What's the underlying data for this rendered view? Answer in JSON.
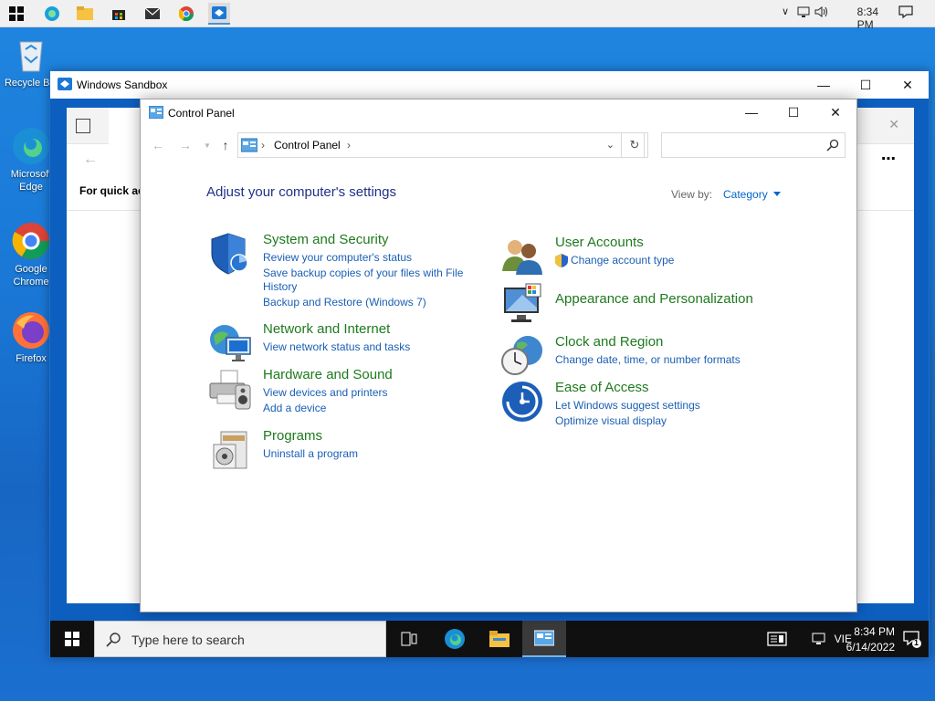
{
  "host_tray": {
    "time": "8:34 PM"
  },
  "desktop": {
    "icons": [
      "Recycle Bin",
      "Microsoft Edge",
      "Google Chrome",
      "Firefox"
    ]
  },
  "sandbox": {
    "title": "Windows Sandbox",
    "explorer_quick": "For quick ac"
  },
  "sandbox_taskbar": {
    "search_placeholder": "Type here to search",
    "lang": "VIE",
    "time": "8:34 PM",
    "date": "6/14/2022",
    "notifications": "1"
  },
  "control_panel": {
    "title": "Control Panel",
    "breadcrumb": "Control Panel",
    "heading": "Adjust your computer's settings",
    "view_by_label": "View by:",
    "view_by_value": "Category",
    "categories": [
      {
        "title": "System and Security",
        "icon": "shield-icon",
        "links": [
          "Review your computer's status",
          "Save backup copies of your files with File History",
          "Backup and Restore (Windows 7)"
        ]
      },
      {
        "title": "Network and Internet",
        "icon": "network-icon",
        "links": [
          "View network status and tasks"
        ]
      },
      {
        "title": "Hardware and Sound",
        "icon": "printer-icon",
        "links": [
          "View devices and printers",
          "Add a device"
        ]
      },
      {
        "title": "Programs",
        "icon": "programs-icon",
        "links": [
          "Uninstall a program"
        ]
      },
      {
        "title": "User Accounts",
        "icon": "users-icon",
        "links": [
          "Change account type"
        ]
      },
      {
        "title": "Appearance and Personalization",
        "icon": "display-icon",
        "links": []
      },
      {
        "title": "Clock and Region",
        "icon": "clock-icon",
        "links": [
          "Change date, time, or number formats"
        ]
      },
      {
        "title": "Ease of Access",
        "icon": "ease-of-access-icon",
        "links": [
          "Let Windows suggest settings",
          "Optimize visual display"
        ]
      }
    ]
  },
  "colors": {
    "link": "#1a5fb4",
    "category_title": "#1e7a1e",
    "heading": "#1e3287",
    "desktop": "#1a78d6"
  }
}
